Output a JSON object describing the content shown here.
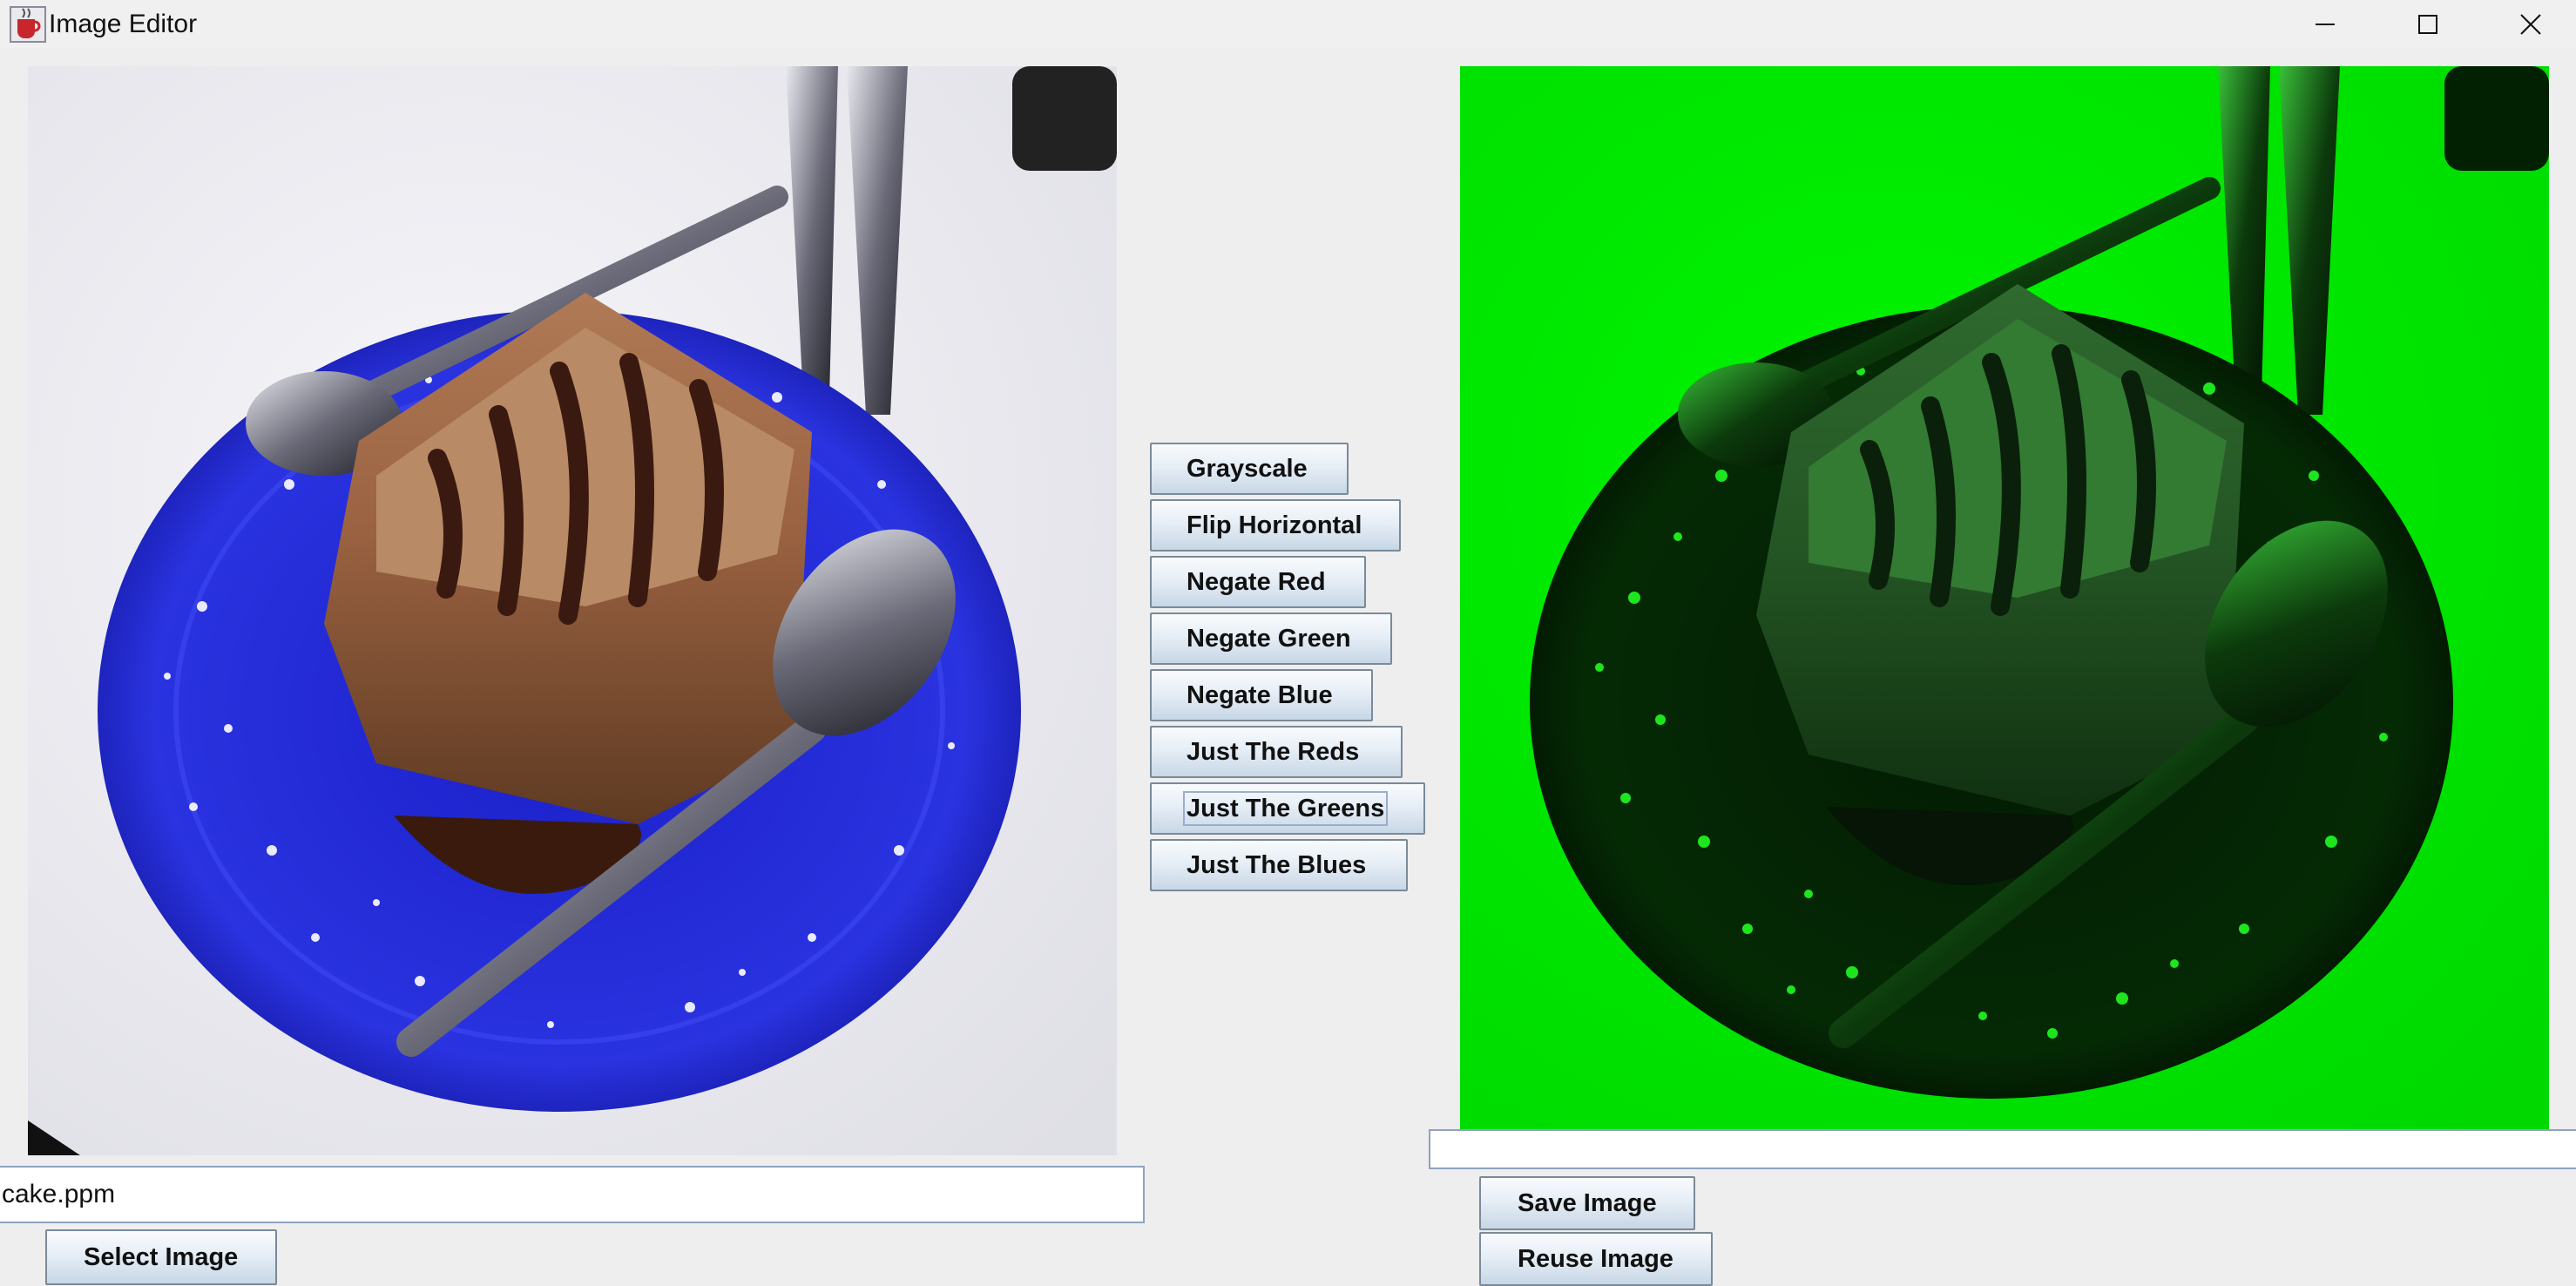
{
  "window": {
    "title": "Image Editor",
    "icon": "java-cup-icon",
    "controls": [
      "minimize-icon",
      "maximize-icon",
      "close-icon"
    ]
  },
  "panes": {
    "original": {
      "description_icon": "image-original",
      "dominant_color": "#2a2fd6"
    },
    "result": {
      "description_icon": "image-greens",
      "dominant_color": "#00f000"
    }
  },
  "operations": [
    {
      "label": "Grayscale"
    },
    {
      "label": "Flip Horizontal"
    },
    {
      "label": "Negate Red"
    },
    {
      "label": "Negate Green"
    },
    {
      "label": "Negate Blue"
    },
    {
      "label": "Just The Reds"
    },
    {
      "label": "Just The Greens"
    },
    {
      "label": "Just The Blues"
    }
  ],
  "focused_operation": "Just The Greens",
  "filename": {
    "value": "cake.ppm"
  },
  "output": {
    "value": ""
  },
  "buttons": {
    "select": "Select Image",
    "save": "Save Image",
    "reuse": "Reuse Image"
  }
}
